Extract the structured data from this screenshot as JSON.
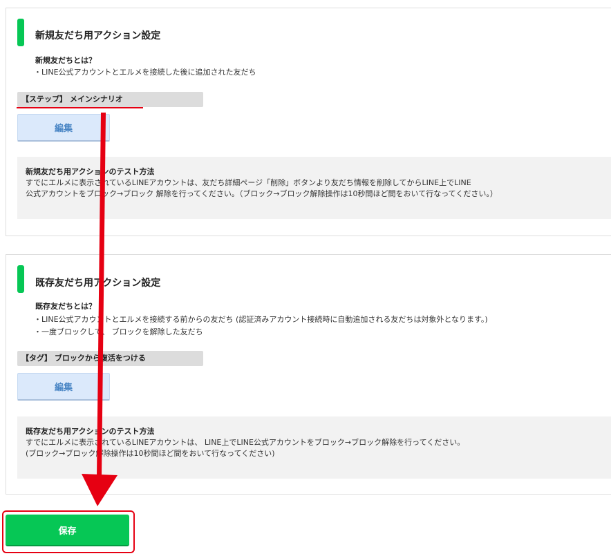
{
  "new_friend_section": {
    "title": "新規友だち用アクション設定",
    "definition_title": "新規友だちとは？",
    "definition_lines": [
      "・LINE公式アカウントとエルメを接続した後に追加された友だち"
    ],
    "scenario_label": "【ステップ】 メインシナリオ",
    "edit_label": "編集",
    "test_title": "新規友だち用アクションのテスト方法",
    "test_lines": [
      "すでにエルメに表示されているLINEアカウントは、友だち詳細ページ「削除」ボタンより友だち情報を削除してからLINE上でLINE",
      "公式アカウントをブロック→ブロック 解除を行ってください。（ブロック→ブロック解除操作は10秒間ほど間をおいて行なってください。）"
    ]
  },
  "existing_friend_section": {
    "title": "既存友だち用アクション設定",
    "definition_title": "既存友だちとは？",
    "definition_lines": [
      "・LINE公式アカウントとエルメを接続する前からの友だち (認証済みアカウント接続時に自動追加される友だちは対象外となります。)",
      "・一度ブロックして、 ブロックを解除した友だち"
    ],
    "tag_label": "【タグ】 ブロックから復活をつける",
    "edit_label": "編集",
    "test_title": "既存友だち用アクションのテスト方法",
    "test_lines": [
      "すでにエルメに表示されているLINEアカウントは、 LINE上でLINE公式アカウントをブロック→ブロック解除を行ってください。",
      "(ブロック→ブロック解除操作は10秒間ほど間をおいて行なってください)"
    ]
  },
  "save_label": "保存",
  "colors": {
    "accent_green": "#06c755",
    "annotation_red": "#e60012",
    "edit_button_bg": "#dbe9fb"
  }
}
